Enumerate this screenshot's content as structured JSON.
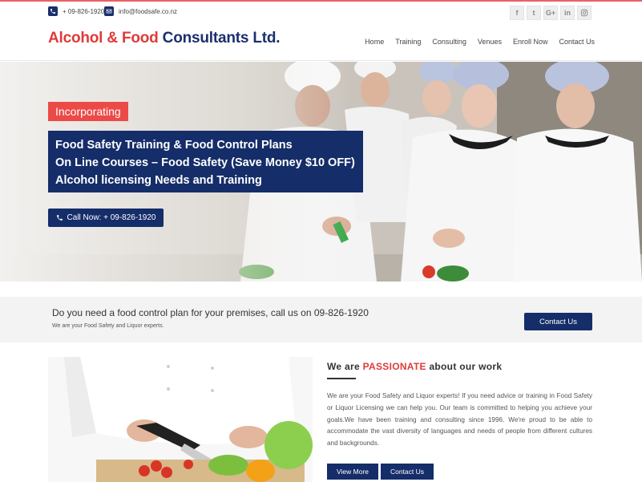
{
  "topbar": {
    "phone": "+ 09-826-1920",
    "email": "info@foodsafe.co.nz",
    "socials": [
      "f",
      "t",
      "G+",
      "in",
      "ig"
    ]
  },
  "header": {
    "logo_part1": "Alcohol & Food",
    "logo_part2": "Consultants Ltd.",
    "nav": [
      "Home",
      "Training",
      "Consulting",
      "Venues",
      "Enroll Now",
      "Contact Us"
    ]
  },
  "hero": {
    "tag": "Incorporating",
    "lines": [
      "Food Safety Training & Food Control Plans",
      "On Line Courses – Food Safety (Save Money $10 OFF)",
      "Alcohol licensing Needs and Training"
    ],
    "call_label": "Call Now: + 09-826-1920"
  },
  "band": {
    "title": "Do you need a food control plan for your premises, call us on 09-826-1920",
    "subtitle": "We are your Food Safety and Liquor experts.",
    "button": "Contact Us"
  },
  "about": {
    "title_pre": "We are",
    "title_accent": "PASSIONATE",
    "title_post": "about our work",
    "body": "We are your Food Safety and Liquor experts! If you need advice or training in Food Safety or Liquor Licensing we can help you. Our team is committed to helping you achieve your goals.We have been training and consulting since 1996. We're proud to be able to accommodate the vast diversity of languages and needs of people from different cultures and backgrounds.",
    "btn_view": "View More",
    "btn_contact": "Contact Us"
  },
  "colors": {
    "brand_navy": "#152d69",
    "brand_red": "#e03a3a",
    "tag_red": "#ec4a47"
  }
}
